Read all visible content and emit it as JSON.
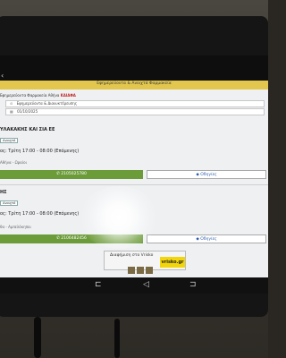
{
  "header": {
    "title": "Εφημερεύοντα & Ανοιχτά Φαρμακεία"
  },
  "filter": {
    "prefix": "Εφημερεύοντα Φαρμακεία",
    "city": "Αθήνα",
    "area": "ΚΑΙΑΦΑ"
  },
  "search": {
    "type_label": "Εφημερεύοντα & Διανυκτέρευσης",
    "date": "01/10/2025"
  },
  "pharmacies": [
    {
      "name": "ΥΛΑΚΑΚΗΣ ΚΑΙ ΣΙΑ ΕΕ",
      "badge": "Ανοιχτό",
      "hours": "ος: Τρίτη 17:00 - 08:00 (Επόμενης)",
      "address": "Αθήνα - Ωραίοι",
      "phone": "2105025780",
      "directions": "Οδηγίες"
    },
    {
      "name": "ΗΣ",
      "badge": "Ανοιχτό",
      "hours": "ος: Τρίτη 17:00 - 08:00 (Επόμενης)",
      "address": "θα - Αμπελόκηποι",
      "phone": "2106482456",
      "directions": "Οδηγίες"
    }
  ],
  "ad": {
    "label": "Διαφήμιση στο Vrisko",
    "brand": "vrisko.gr"
  },
  "icons": {
    "back": "back-arrow-icon",
    "location": "location-icon",
    "calendar": "calendar-icon",
    "phone": "phone-icon",
    "directions": "directions-icon",
    "nav_back": "nav-back-icon",
    "nav_home": "nav-home-icon",
    "nav_recent": "nav-recent-icon"
  }
}
